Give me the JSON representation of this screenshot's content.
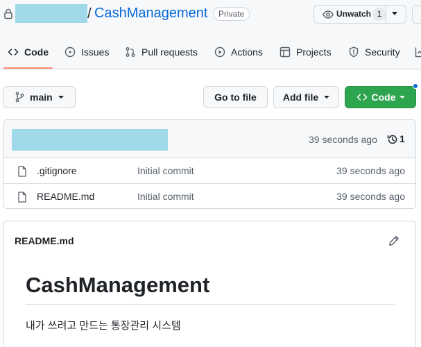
{
  "repo": {
    "separator": "/",
    "name": "CashManagement",
    "visibility": "Private"
  },
  "watch": {
    "label": "Unwatch",
    "count": "1"
  },
  "tabs": [
    {
      "label": "Code",
      "icon": "code-icon",
      "selected": true
    },
    {
      "label": "Issues",
      "icon": "issue-icon",
      "selected": false
    },
    {
      "label": "Pull requests",
      "icon": "pull-request-icon",
      "selected": false
    },
    {
      "label": "Actions",
      "icon": "play-icon",
      "selected": false
    },
    {
      "label": "Projects",
      "icon": "table-icon",
      "selected": false
    },
    {
      "label": "Security",
      "icon": "shield-icon",
      "selected": false
    }
  ],
  "toolbar": {
    "branch": "main",
    "go_to_file": "Go to file",
    "add_file": "Add file",
    "code": "Code"
  },
  "latest_commit": {
    "time": "39 seconds ago",
    "count": "1"
  },
  "files": [
    {
      "name": ".gitignore",
      "message": "Initial commit",
      "time": "39 seconds ago"
    },
    {
      "name": "README.md",
      "message": "Initial commit",
      "time": "39 seconds ago"
    }
  ],
  "readme": {
    "filename": "README.md",
    "heading": "CashManagement",
    "body": "내가 쓰려고 만드는 통장관리 시스템"
  },
  "colors": {
    "link": "#0969da",
    "primary_button": "#2da44e",
    "tab_underline": "#fd8c73",
    "redaction": "#9fd9ea"
  }
}
